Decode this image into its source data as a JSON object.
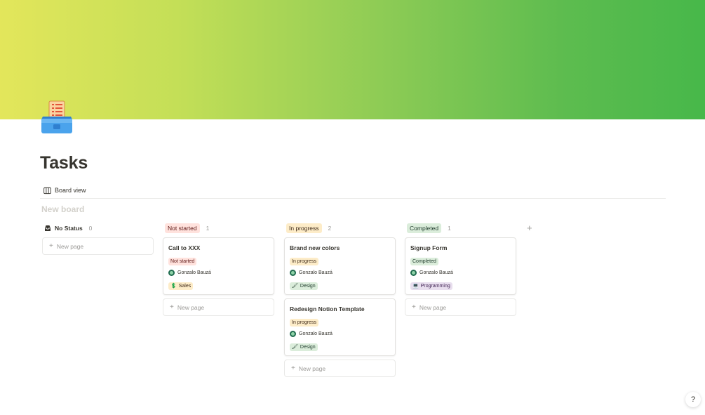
{
  "page": {
    "title": "Tasks",
    "icon": "clipboard-box-icon",
    "cover_colors": [
      "#e3e65b",
      "#47b84a"
    ]
  },
  "views": {
    "active_tab": "Board view"
  },
  "board": {
    "title_placeholder": "New board",
    "new_page_label": "New page",
    "columns": [
      {
        "name": "No Status",
        "count": "0",
        "pill_bg": "",
        "pill_color": "#37352f",
        "cards": []
      },
      {
        "name": "Not started",
        "count": "1",
        "pill_bg": "#ffe2dd",
        "pill_color": "#5d1715",
        "cards": [
          {
            "title": "Call to XXX",
            "status": "Not started",
            "person": "Gonzalo Bauzá",
            "tag": "Sales",
            "tag_icon": "💲"
          }
        ]
      },
      {
        "name": "In progress",
        "count": "2",
        "pill_bg": "#fdecc8",
        "pill_color": "#402c1b",
        "cards": [
          {
            "title": "Brand new colors",
            "status": "In progress",
            "person": "Gonzalo Bauzá",
            "tag": "Design",
            "tag_icon": "🖌"
          },
          {
            "title": "Redesign Notion Template",
            "status": "In progress",
            "person": "Gonzalo Bauzá",
            "tag": "Design",
            "tag_icon": "🖌"
          }
        ]
      },
      {
        "name": "Completed",
        "count": "1",
        "pill_bg": "#dbeddb",
        "pill_color": "#1c3829",
        "cards": [
          {
            "title": "Signup Form",
            "status": "Completed",
            "person": "Gonzalo Bauzá",
            "tag": "Programming",
            "tag_icon": "💻"
          }
        ]
      }
    ]
  },
  "tag_colors": {
    "Sales": "#fdecc8",
    "Design": "#dbeddb",
    "Programming": "#e8deee"
  },
  "help_button": {
    "label": "?"
  }
}
